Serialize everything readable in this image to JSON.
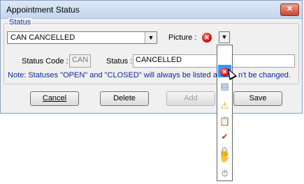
{
  "window": {
    "title": "Appointment Status",
    "close_glyph": "✕"
  },
  "status_group": {
    "label": "Status",
    "combo_value": "CAN CANCELLED",
    "picture_label": "Picture :",
    "status_code_label": "Status Code :",
    "status_code_value": "CAN",
    "status_label": "Status :",
    "status_value": "CANCELLED",
    "note_before": "Note: Statuses \"OPEN\" and \"CLOSED\" will always be listed an",
    "note_after": "n't be changed."
  },
  "buttons": {
    "cancel": "Cancel",
    "delete": "Delete",
    "add": "Add",
    "save": "Save"
  },
  "picture_dropdown": {
    "items": [
      "error-icon",
      "disk-icon",
      "warning-icon",
      "clipboard-icon",
      "clipboard-check-icon",
      "lock-icon",
      "hand-icon",
      "clock-icon"
    ]
  }
}
